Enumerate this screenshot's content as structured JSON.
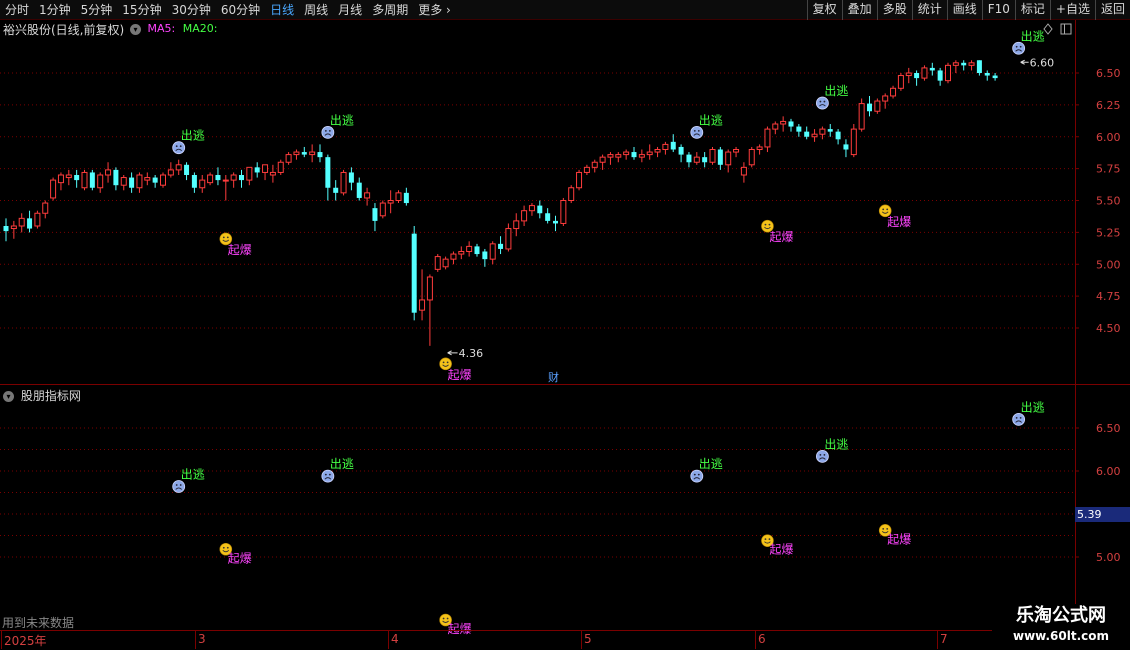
{
  "toolbar": {
    "periods": [
      "分时",
      "1分钟",
      "5分钟",
      "15分钟",
      "30分钟",
      "60分钟",
      "日线",
      "周线",
      "月线",
      "多周期",
      "更多"
    ],
    "active_period": "日线",
    "right_buttons": [
      "复权",
      "叠加",
      "多股",
      "统计",
      "画线",
      "F10",
      "标记",
      "+自选",
      "返回"
    ]
  },
  "main_chart": {
    "title": "裕兴股份(日线,前复权)",
    "ma_labels": [
      "MA5:",
      "MA20:"
    ],
    "ma_colors": [
      "#ff44ff",
      "#44ff44"
    ],
    "low_label": "4.36",
    "high_label": "6.60",
    "finance_marker": "财"
  },
  "indicator_panel": {
    "title": "股朋指标网",
    "current_value": "5.39",
    "future_data_note": "用到未来数据"
  },
  "signals": {
    "buy_label": "起爆",
    "sell_label": "出逃"
  },
  "date_axis": {
    "labels": [
      "2025年",
      "3",
      "4",
      "5",
      "6",
      "7"
    ]
  },
  "watermark": {
    "logo": "乐淘公式网",
    "url": "www.60lt.com"
  },
  "colors": {
    "up_candle": "#ff3c3c",
    "down_candle": "#54ffff",
    "grid": "#7a0000",
    "axis_text": "#d34040",
    "buy_signal": "#ff44ff",
    "sell_signal": "#44ff44",
    "active_tab": "#4aa8ff"
  },
  "chart_data": [
    {
      "type": "candlestick",
      "title": "裕兴股份(日线,前复权)",
      "y_ticks": [
        "6.50",
        "6.25",
        "6.00",
        "5.75",
        "5.50",
        "5.25",
        "5.00",
        "4.75",
        "4.50"
      ],
      "ylim": [
        4.2,
        6.85
      ],
      "x_labels": [
        "2025年",
        "3",
        "4",
        "5",
        "6",
        "7"
      ],
      "ohlc": [
        [
          5.3,
          5.36,
          5.18,
          5.26
        ],
        [
          5.28,
          5.34,
          5.2,
          5.3
        ],
        [
          5.3,
          5.4,
          5.25,
          5.36
        ],
        [
          5.36,
          5.42,
          5.25,
          5.28
        ],
        [
          5.3,
          5.42,
          5.28,
          5.4
        ],
        [
          5.4,
          5.5,
          5.36,
          5.48
        ],
        [
          5.52,
          5.68,
          5.5,
          5.66
        ],
        [
          5.64,
          5.72,
          5.58,
          5.7
        ],
        [
          5.68,
          5.74,
          5.62,
          5.7
        ],
        [
          5.7,
          5.74,
          5.6,
          5.66
        ],
        [
          5.6,
          5.74,
          5.58,
          5.72
        ],
        [
          5.72,
          5.74,
          5.58,
          5.6
        ],
        [
          5.6,
          5.72,
          5.56,
          5.7
        ],
        [
          5.7,
          5.8,
          5.64,
          5.74
        ],
        [
          5.74,
          5.76,
          5.58,
          5.62
        ],
        [
          5.62,
          5.7,
          5.58,
          5.68
        ],
        [
          5.68,
          5.72,
          5.56,
          5.6
        ],
        [
          5.6,
          5.72,
          5.56,
          5.7
        ],
        [
          5.66,
          5.72,
          5.62,
          5.68
        ],
        [
          5.68,
          5.7,
          5.6,
          5.64
        ],
        [
          5.62,
          5.72,
          5.6,
          5.7
        ],
        [
          5.7,
          5.8,
          5.68,
          5.74
        ],
        [
          5.74,
          5.82,
          5.7,
          5.78
        ],
        [
          5.78,
          5.8,
          5.66,
          5.7
        ],
        [
          5.7,
          5.72,
          5.56,
          5.6
        ],
        [
          5.6,
          5.7,
          5.56,
          5.66
        ],
        [
          5.64,
          5.72,
          5.62,
          5.7
        ],
        [
          5.7,
          5.76,
          5.62,
          5.66
        ],
        [
          5.66,
          5.7,
          5.5,
          5.66
        ],
        [
          5.66,
          5.72,
          5.6,
          5.7
        ],
        [
          5.7,
          5.74,
          5.6,
          5.66
        ],
        [
          5.66,
          5.76,
          5.62,
          5.76
        ],
        [
          5.76,
          5.8,
          5.68,
          5.72
        ],
        [
          5.72,
          5.78,
          5.66,
          5.78
        ],
        [
          5.7,
          5.78,
          5.64,
          5.72
        ],
        [
          5.72,
          5.82,
          5.7,
          5.8
        ],
        [
          5.8,
          5.88,
          5.78,
          5.86
        ],
        [
          5.86,
          5.9,
          5.82,
          5.88
        ],
        [
          5.88,
          5.92,
          5.84,
          5.86
        ],
        [
          5.86,
          5.94,
          5.8,
          5.88
        ],
        [
          5.88,
          5.94,
          5.8,
          5.84
        ],
        [
          5.84,
          5.86,
          5.5,
          5.6
        ],
        [
          5.6,
          5.66,
          5.5,
          5.56
        ],
        [
          5.56,
          5.74,
          5.54,
          5.72
        ],
        [
          5.72,
          5.76,
          5.58,
          5.64
        ],
        [
          5.64,
          5.68,
          5.5,
          5.52
        ],
        [
          5.52,
          5.6,
          5.46,
          5.56
        ],
        [
          5.44,
          5.48,
          5.26,
          5.34
        ],
        [
          5.38,
          5.5,
          5.36,
          5.48
        ],
        [
          5.48,
          5.58,
          5.4,
          5.5
        ],
        [
          5.5,
          5.58,
          5.48,
          5.56
        ],
        [
          5.56,
          5.6,
          5.46,
          5.48
        ],
        [
          5.24,
          5.3,
          4.56,
          4.62
        ],
        [
          4.64,
          4.96,
          4.56,
          4.72
        ],
        [
          4.72,
          4.92,
          4.36,
          4.9
        ],
        [
          4.96,
          5.08,
          4.94,
          5.06
        ],
        [
          4.98,
          5.06,
          4.96,
          5.04
        ],
        [
          5.04,
          5.1,
          5.0,
          5.08
        ],
        [
          5.08,
          5.14,
          5.04,
          5.1
        ],
        [
          5.1,
          5.18,
          5.06,
          5.14
        ],
        [
          5.14,
          5.16,
          5.06,
          5.08
        ],
        [
          5.1,
          5.12,
          4.98,
          5.04
        ],
        [
          5.04,
          5.18,
          5.0,
          5.16
        ],
        [
          5.16,
          5.22,
          5.08,
          5.12
        ],
        [
          5.12,
          5.32,
          5.1,
          5.28
        ],
        [
          5.28,
          5.4,
          5.22,
          5.34
        ],
        [
          5.34,
          5.46,
          5.3,
          5.42
        ],
        [
          5.42,
          5.48,
          5.38,
          5.46
        ],
        [
          5.46,
          5.5,
          5.36,
          5.4
        ],
        [
          5.4,
          5.44,
          5.32,
          5.34
        ],
        [
          5.34,
          5.38,
          5.26,
          5.32
        ],
        [
          5.32,
          5.52,
          5.3,
          5.5
        ],
        [
          5.5,
          5.62,
          5.48,
          5.6
        ],
        [
          5.6,
          5.74,
          5.58,
          5.72
        ],
        [
          5.72,
          5.78,
          5.7,
          5.76
        ],
        [
          5.76,
          5.82,
          5.72,
          5.8
        ],
        [
          5.8,
          5.86,
          5.74,
          5.84
        ],
        [
          5.84,
          5.88,
          5.78,
          5.86
        ],
        [
          5.84,
          5.88,
          5.8,
          5.86
        ],
        [
          5.86,
          5.9,
          5.82,
          5.88
        ],
        [
          5.88,
          5.92,
          5.82,
          5.84
        ],
        [
          5.84,
          5.9,
          5.8,
          5.86
        ],
        [
          5.86,
          5.94,
          5.82,
          5.88
        ],
        [
          5.88,
          5.92,
          5.84,
          5.9
        ],
        [
          5.9,
          5.96,
          5.86,
          5.94
        ],
        [
          5.96,
          6.02,
          5.88,
          5.9
        ],
        [
          5.92,
          5.94,
          5.8,
          5.86
        ],
        [
          5.86,
          5.88,
          5.76,
          5.8
        ],
        [
          5.8,
          5.88,
          5.78,
          5.84
        ],
        [
          5.84,
          5.88,
          5.76,
          5.8
        ],
        [
          5.8,
          5.92,
          5.78,
          5.9
        ],
        [
          5.9,
          5.92,
          5.74,
          5.78
        ],
        [
          5.78,
          5.9,
          5.72,
          5.88
        ],
        [
          5.88,
          5.92,
          5.84,
          5.9
        ],
        [
          5.7,
          5.8,
          5.64,
          5.76
        ],
        [
          5.78,
          5.92,
          5.76,
          5.9
        ],
        [
          5.9,
          5.94,
          5.86,
          5.92
        ],
        [
          5.92,
          6.08,
          5.88,
          6.06
        ],
        [
          6.06,
          6.12,
          6.02,
          6.1
        ],
        [
          6.1,
          6.16,
          6.04,
          6.12
        ],
        [
          6.12,
          6.14,
          6.04,
          6.08
        ],
        [
          6.08,
          6.1,
          6.0,
          6.04
        ],
        [
          6.04,
          6.08,
          5.98,
          6.0
        ],
        [
          6.0,
          6.06,
          5.96,
          6.02
        ],
        [
          6.02,
          6.08,
          5.98,
          6.06
        ],
        [
          6.06,
          6.1,
          6.0,
          6.04
        ],
        [
          6.04,
          6.06,
          5.94,
          5.98
        ],
        [
          5.94,
          5.98,
          5.84,
          5.9
        ],
        [
          5.86,
          6.1,
          5.84,
          6.06
        ],
        [
          6.06,
          6.3,
          6.04,
          6.26
        ],
        [
          6.26,
          6.32,
          6.16,
          6.2
        ],
        [
          6.2,
          6.3,
          6.18,
          6.28
        ],
        [
          6.28,
          6.34,
          6.22,
          6.32
        ],
        [
          6.32,
          6.4,
          6.3,
          6.38
        ],
        [
          6.38,
          6.5,
          6.36,
          6.48
        ],
        [
          6.48,
          6.54,
          6.42,
          6.5
        ],
        [
          6.5,
          6.52,
          6.4,
          6.46
        ],
        [
          6.46,
          6.56,
          6.44,
          6.54
        ],
        [
          6.54,
          6.58,
          6.48,
          6.52
        ],
        [
          6.52,
          6.54,
          6.4,
          6.44
        ],
        [
          6.44,
          6.58,
          6.42,
          6.56
        ],
        [
          6.56,
          6.6,
          6.5,
          6.58
        ],
        [
          6.58,
          6.6,
          6.52,
          6.56
        ],
        [
          6.56,
          6.6,
          6.52,
          6.58
        ],
        [
          6.6,
          6.6,
          6.48,
          6.5
        ],
        [
          6.5,
          6.52,
          6.44,
          6.48
        ],
        [
          6.48,
          6.5,
          6.44,
          6.46
        ]
      ],
      "ma5_color": "#ff44ff",
      "ma20_color": "#44ff44"
    },
    {
      "type": "scatter",
      "title": "股朋指标网",
      "y_ticks": [
        "6.50",
        "6.00",
        "5.50",
        "5.00"
      ],
      "ylim": [
        4.8,
        6.95
      ],
      "current_value": "5.39",
      "buy_signals": [
        {
          "index": 28,
          "price": 5.34,
          "label": "起爆"
        },
        {
          "index": 56,
          "price": 4.36,
          "label": "起爆"
        },
        {
          "index": 97,
          "price": 5.44,
          "label": "起爆"
        },
        {
          "index": 112,
          "price": 5.56,
          "label": "起爆"
        }
      ],
      "sell_signals": [
        {
          "index": 22,
          "price": 5.82,
          "label": "出逃"
        },
        {
          "index": 41,
          "price": 5.94,
          "label": "出逃"
        },
        {
          "index": 88,
          "price": 5.94,
          "label": "出逃"
        },
        {
          "index": 104,
          "price": 6.17,
          "label": "出逃"
        },
        {
          "index": 129,
          "price": 6.6,
          "label": "出逃"
        }
      ]
    }
  ]
}
